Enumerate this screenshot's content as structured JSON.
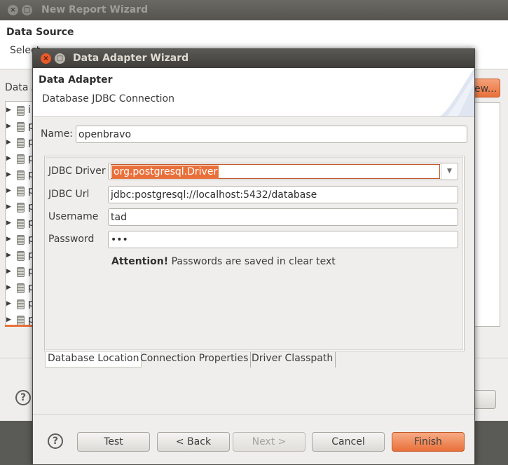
{
  "background_window": {
    "title": "New Report Wizard",
    "close_glyph": "×",
    "maximize_glyph": "□",
    "section_title": "Data Source",
    "section_description": "Select",
    "list_label": "Data A",
    "list_rows": [
      {
        "text": "i"
      },
      {
        "text": "p"
      },
      {
        "text": "p"
      },
      {
        "text": "p"
      },
      {
        "text": "p"
      },
      {
        "text": "p"
      },
      {
        "text": "p"
      },
      {
        "text": "p"
      },
      {
        "text": "p"
      },
      {
        "text": "p"
      },
      {
        "text": "p"
      },
      {
        "text": "p"
      },
      {
        "text": "p"
      },
      {
        "text": "p"
      }
    ],
    "new_button_label": "ew...",
    "help_glyph": "?"
  },
  "dialog": {
    "title": "Data Adapter Wizard",
    "close_glyph": "×",
    "maximize_glyph": "□",
    "section_title": "Data Adapter",
    "section_description": "Database JDBC Connection",
    "name_label": "Name:",
    "name_value": "openbravo",
    "fields": {
      "jdbc_driver_label": "JDBC Driver",
      "jdbc_driver_value": "org.postgresql.Driver",
      "jdbc_url_label": "JDBC Url",
      "jdbc_url_value": "jdbc:postgresql://localhost:5432/database",
      "username_label": "Username",
      "username_value": "tad",
      "password_label": "Password",
      "password_value": "•••"
    },
    "attention_bold": "Attention!",
    "attention_text": " Passwords are saved in clear text",
    "tabs": [
      {
        "label": "Database Location",
        "active": true
      },
      {
        "label": "Connection Properties",
        "active": false
      },
      {
        "label": "Driver Classpath",
        "active": false
      }
    ],
    "help_glyph": "?",
    "buttons": {
      "test": "Test",
      "back": "< Back",
      "next": "Next >",
      "cancel": "Cancel",
      "finish": "Finish"
    },
    "colors": {
      "accent": "#e9703a",
      "titlebar": "#3f3e3a",
      "window_bg": "#efeeec"
    }
  }
}
